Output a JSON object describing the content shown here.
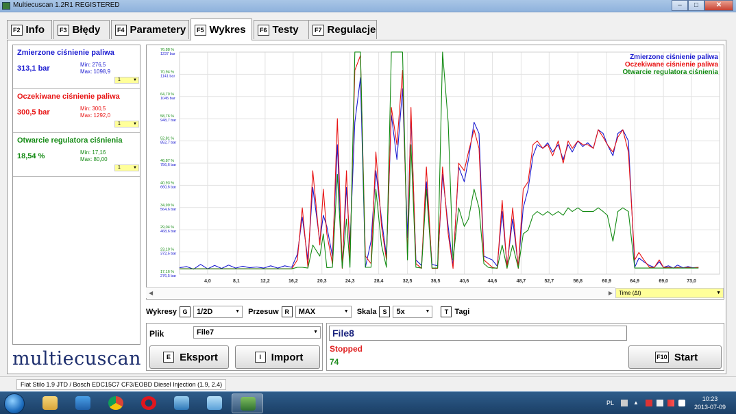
{
  "window": {
    "title": "Multiecuscan 1.2R1 REGISTERED"
  },
  "tabs": [
    {
      "key": "F2",
      "label": "Info"
    },
    {
      "key": "F3",
      "label": "Błędy"
    },
    {
      "key": "F4",
      "label": "Parametery"
    },
    {
      "key": "F5",
      "label": "Wykres"
    },
    {
      "key": "F6",
      "label": "Testy"
    },
    {
      "key": "F7",
      "label": "Regulacje"
    }
  ],
  "active_tab": "Wykres",
  "params": [
    {
      "name": "Zmierzone ciśnienie paliwa",
      "value": "313,1 bar",
      "min": "Min: 276,5",
      "max": "Max: 1098,9",
      "scale": "1",
      "color": "#1a1ad0"
    },
    {
      "name": "Oczekiwane ciśnienie paliwa",
      "value": "300,5 bar",
      "min": "Min: 300,5",
      "max": "Max: 1292,0",
      "scale": "1",
      "color": "#e81414"
    },
    {
      "name": "Otwarcie regulatora ciśnienia",
      "value": "18,54 %",
      "min": "Min: 17,16",
      "max": "Max: 80,00",
      "scale": "1",
      "color": "#138a13"
    }
  ],
  "logo": "multiecuscan",
  "chart_data": {
    "type": "line",
    "y_pct_labels": [
      "76,88 %",
      "70,94 %",
      "64,70 %",
      "58,76 %",
      "52,81 %",
      "46,87 %",
      "40,93 %",
      "34,99 %",
      "29,04 %",
      "23,10 %",
      "17,16 %"
    ],
    "y_bar_labels": [
      "1237 bar",
      "1141 bar",
      "1045 bar",
      "948,7 bar",
      "852,7 bar",
      "756,6 bar",
      "660,6 bar",
      "564,6 bar",
      "468,6 bar",
      "372,5 bar",
      "276,5 bar"
    ],
    "ylim_pct": [
      17.16,
      76.88
    ],
    "x_ticks": [
      "4,0",
      "8,1",
      "12,2",
      "16,2",
      "20,3",
      "24,3",
      "28,4",
      "32,5",
      "36,5",
      "40,6",
      "44,6",
      "48,7",
      "52,7",
      "56,8",
      "60,9",
      "64,9",
      "69,0",
      "73,0"
    ],
    "xlim": [
      0,
      77
    ],
    "x_axis_selector": "Time (Δt)",
    "grid": true,
    "legend_placement": "top-right",
    "series": [
      {
        "name": "Zmierzone ciśnienie paliwa",
        "color": "#1a1ad0",
        "x": [
          0,
          1,
          2,
          3,
          4,
          5,
          6,
          7,
          8,
          9,
          10,
          11,
          12,
          13,
          14,
          15,
          16,
          16.8,
          17.5,
          18.3,
          19,
          20,
          20.5,
          21,
          21.8,
          22.5,
          23.2,
          23.8,
          24.3,
          25,
          25.8,
          26.5,
          27.3,
          28,
          28.8,
          29.5,
          30.2,
          31,
          31.8,
          32.5,
          33,
          33.7,
          34.5,
          35.2,
          36,
          36.8,
          37.5,
          38.3,
          39,
          39.8,
          40.6,
          41.2,
          42,
          42.7,
          43.4,
          44,
          44.6,
          45.3,
          46,
          46.7,
          47.5,
          48.3,
          49,
          49.7,
          50.4,
          51,
          51.8,
          52.5,
          53.2,
          54,
          54.7,
          55.4,
          56,
          56.8,
          57.5,
          58.2,
          59,
          59.7,
          60.4,
          61,
          61.8,
          62.5,
          63.2,
          64,
          64.9,
          65.5,
          66.2,
          67,
          67.7,
          68.4,
          69,
          69.7,
          70.4,
          71,
          71.8,
          72.5,
          73.2,
          74
        ],
        "y": [
          18.9,
          19.2,
          18.5,
          19.8,
          18.6,
          19.5,
          18.7,
          19.6,
          18.8,
          19.3,
          18.9,
          19.1,
          18.8,
          19.4,
          18.8,
          19.4,
          19,
          22.5,
          32.5,
          21,
          40.5,
          26,
          33,
          30,
          22,
          52,
          19.5,
          40.5,
          25,
          58,
          70,
          19,
          26,
          45,
          32,
          22,
          60,
          48,
          67,
          27,
          60,
          21,
          19.5,
          42,
          19.8,
          19.4,
          44,
          30,
          19.3,
          46,
          42,
          48,
          58,
          55,
          22,
          21.5,
          21,
          19.3,
          34,
          19.5,
          32,
          19.3,
          35,
          40,
          49,
          52,
          51,
          52.5,
          50,
          52,
          48,
          52,
          50,
          53,
          51.5,
          52.5,
          51,
          56,
          55,
          52,
          49,
          55,
          56,
          53,
          19,
          21.5,
          20.5,
          19.5,
          19,
          20.5,
          19,
          19.4,
          18.8,
          19.6,
          18.9,
          19.2,
          18.9,
          19
        ]
      },
      {
        "name": "Oczekiwane ciśnienie paliwa",
        "color": "#e81414",
        "x": [
          0,
          1,
          2,
          3,
          4,
          5,
          6,
          7,
          8,
          9,
          10,
          11,
          12,
          13,
          14,
          15,
          16,
          16.8,
          17.5,
          18.3,
          19,
          20,
          20.5,
          21,
          21.8,
          22.5,
          23.2,
          23.8,
          24.3,
          25,
          25.8,
          26.5,
          27.3,
          28,
          28.8,
          29.5,
          30.2,
          31,
          31.8,
          32.5,
          33,
          33.7,
          34.5,
          35.2,
          36,
          36.8,
          37.5,
          38.3,
          39,
          39.8,
          40.6,
          41.2,
          42,
          42.7,
          43.4,
          44,
          44.6,
          45.3,
          46,
          46.7,
          47.5,
          48.3,
          49,
          49.7,
          50.4,
          51,
          51.8,
          52.5,
          53.2,
          54,
          54.7,
          55.4,
          56,
          56.8,
          57.5,
          58.2,
          59,
          59.7,
          60.4,
          61,
          61.8,
          62.5,
          63.2,
          64,
          64.9,
          65.5,
          66.2,
          67,
          67.7,
          68.4,
          69,
          69.7,
          70.4,
          71,
          71.8,
          72.5,
          73.2,
          74
        ],
        "y": [
          18.6,
          18.6,
          18.6,
          18.6,
          18.6,
          18.6,
          18.6,
          18.6,
          18.6,
          18.6,
          18.6,
          18.6,
          18.6,
          18.6,
          18.6,
          18.6,
          18.6,
          21,
          35,
          19,
          45,
          25,
          40,
          28,
          20,
          59,
          18.7,
          45,
          21,
          72,
          76,
          22,
          20,
          50,
          30,
          21,
          62,
          52,
          72,
          22,
          62,
          20,
          18.7,
          46,
          18.7,
          18.7,
          46,
          28,
          18.7,
          47,
          45,
          50,
          56,
          51,
          21,
          20,
          19,
          18.7,
          37,
          18.7,
          35,
          18.7,
          40,
          42,
          52,
          53,
          51,
          52,
          49,
          53,
          47,
          53,
          51,
          53,
          52,
          52,
          51,
          56,
          54,
          52,
          50,
          54,
          56,
          50,
          21,
          23,
          21,
          19,
          19,
          21,
          19,
          19,
          18.8,
          19,
          18.8,
          19,
          18.8,
          19
        ]
      },
      {
        "name": "Otwarcie regulatora ciśnienia",
        "color": "#138a13",
        "x": [
          0,
          1,
          2,
          3,
          4,
          5,
          6,
          7,
          8,
          9,
          10,
          11,
          12,
          13,
          14,
          15,
          16,
          16.8,
          17.5,
          18.3,
          19,
          20,
          20.5,
          21,
          21.8,
          22.5,
          23.2,
          23.8,
          24.3,
          25,
          25.8,
          26.5,
          27.3,
          28,
          28.8,
          29.5,
          30.2,
          31,
          31.8,
          32.5,
          33,
          33.7,
          34.5,
          35.2,
          36,
          36.8,
          37.5,
          38.3,
          39,
          39.8,
          40.6,
          41.2,
          42,
          42.7,
          43.4,
          44,
          44.6,
          45.3,
          46,
          46.7,
          47.5,
          48.3,
          49,
          49.7,
          50.4,
          51,
          51.8,
          52.5,
          53.2,
          54,
          54.7,
          55.4,
          56,
          56.8,
          57.5,
          58.2,
          59,
          59.7,
          60.4,
          61,
          61.8,
          62.5,
          63.2,
          64,
          64.9,
          65.5,
          66.2,
          67,
          67.7,
          68.4,
          69,
          69.7,
          70.4,
          71,
          71.8,
          72.5,
          73.2,
          74
        ],
        "y": [
          18.6,
          18.6,
          18.6,
          18.6,
          18.6,
          18.6,
          18.6,
          18.6,
          18.6,
          18.6,
          18.6,
          18.6,
          18.6,
          18.6,
          18.6,
          18.6,
          18.6,
          19,
          19,
          18.8,
          25,
          22,
          28,
          18.9,
          19,
          44,
          18.8,
          32,
          19,
          76.9,
          76.9,
          19,
          19,
          40,
          25,
          19,
          76.9,
          76.9,
          76.9,
          21,
          52,
          19,
          18.8,
          40,
          18.8,
          18.8,
          76.9,
          58,
          21,
          35,
          30,
          32,
          40,
          35,
          20,
          19,
          18.8,
          18.8,
          25,
          18.8,
          25,
          18.8,
          28,
          29,
          33,
          34,
          33,
          34,
          33,
          34,
          33,
          35,
          34,
          35,
          34,
          34,
          34,
          35,
          34,
          33,
          26,
          34,
          35,
          34,
          18.8,
          18.8,
          18.8,
          18.8,
          18.8,
          18.8,
          18.8,
          18.8,
          18.8,
          18.8,
          18.8,
          18.8,
          18.8,
          18.8
        ]
      }
    ]
  },
  "controls": {
    "wykresy_label": "Wykresy",
    "wykresy_key": "G",
    "wykresy_value": "1/2D",
    "przesuw_label": "Przesuw",
    "przesuw_key": "R",
    "przesuw_value": "MAX",
    "skala_label": "Skala",
    "skala_key": "S",
    "skala_value": "5x",
    "tagi_label": "Tagi",
    "tagi_key": "T"
  },
  "file": {
    "label": "Plik",
    "selected": "File7",
    "export_key": "E",
    "export_label": "Eksport",
    "import_key": "I",
    "import_label": "Import"
  },
  "status": {
    "filename": "File8",
    "state": "Stopped",
    "count": "74",
    "start_key": "F10",
    "start_label": "Start"
  },
  "vehicle": "Fiat Stilo 1.9 JTD / Bosch EDC15C7 CF3/EOBD Diesel Injection (1.9, 2.4)",
  "taskbar": {
    "lang": "PL",
    "time": "10:23",
    "date": "2013-07-09"
  },
  "colors": {
    "blue": "#1a1ad0",
    "red": "#e81414",
    "green": "#138a13",
    "logo": "#1e2f6e"
  }
}
